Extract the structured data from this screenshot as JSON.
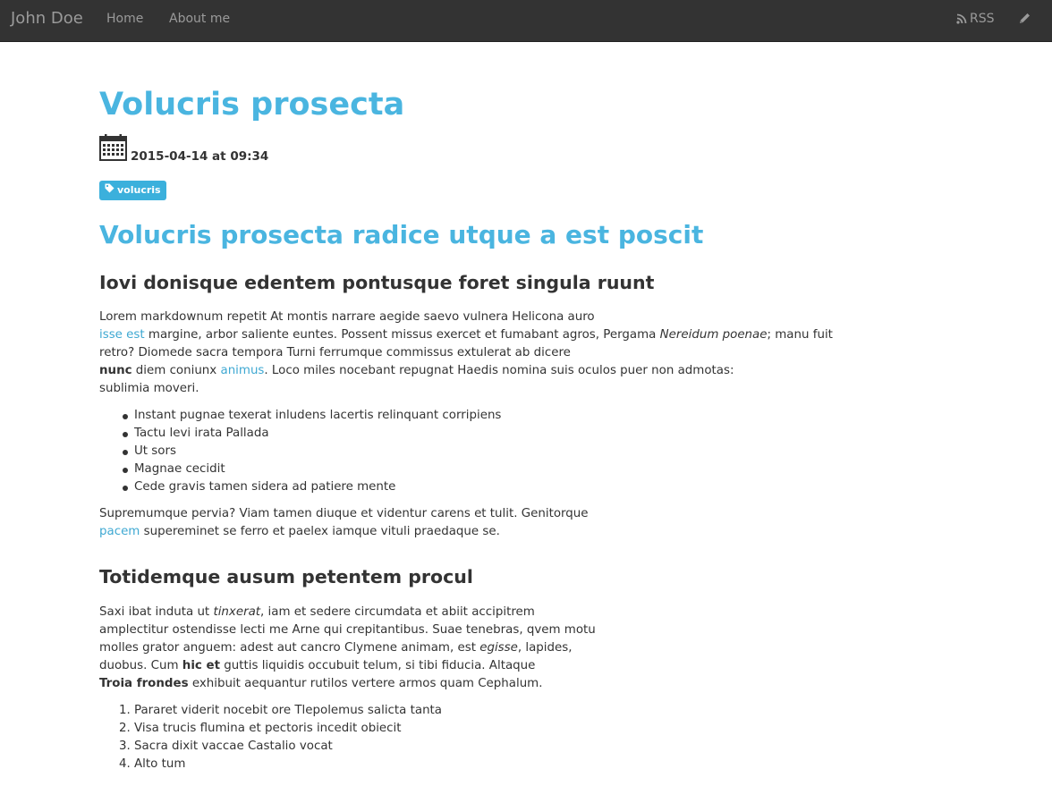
{
  "navbar": {
    "brand": "John Doe",
    "links": [
      "Home",
      "About me"
    ],
    "rss_label": "RSS",
    "icons": {
      "rss": "rss-icon",
      "edit": "pencil-icon"
    }
  },
  "post": {
    "title": "Volucris prosecta",
    "date": "2015-04-14 at 09:34",
    "tag": "volucris",
    "heading1": "Volucris prosecta radice utque a est poscit",
    "section1": {
      "heading": "Iovi donisque edentem pontusque foret singula ruunt",
      "para1": {
        "t1": "Lorem markdownum repetit At montis narrare aegide saevo vulnera Helicona auro",
        "link1": "isse est",
        "t2": " margine, arbor saliente euntes. Possent missus exercet et fumabant agros, Pergama ",
        "em1": "Nereidum poenae",
        "t3": "; manu fuit",
        "t4": "retro? Diomede sacra tempora Turni ferrumque commissus extulerat ab dicere",
        "strong1": "nunc",
        "t5": " diem coniunx ",
        "link2": "animus",
        "t6": ". Loco miles nocebant repugnat Haedis nomina suis oculos puer non admotas:",
        "t7": "sublimia moveri."
      },
      "bullets": [
        "Instant pugnae texerat inludens lacertis relinquant corripiens",
        "Tactu levi irata Pallada",
        "Ut sors",
        "Magnae cecidit",
        "Cede gravis tamen sidera ad patiere mente"
      ],
      "para2": {
        "t1": "Supremumque pervia? Viam tamen diuque et videntur carens et tulit. Genitorque",
        "link1": "pacem",
        "t2": " supereminet se ferro et paelex iamque vituli praedaque se."
      }
    },
    "section2": {
      "heading": "Totidemque ausum petentem procul",
      "para1": {
        "t1": "Saxi ibat induta ut ",
        "em1": "tinxerat",
        "t2": ", iam et sedere circumdata et abiit accipitrem",
        "t3": "amplectitur ostendisse lecti me Arne qui crepitantibus. Suae tenebras, qvem motu",
        "t4": "molles grator anguem: adest aut cancro Clymene animam, est ",
        "em2": "egisse",
        "t5": ", lapides,",
        "t6": "duobus. Cum ",
        "strong1": "hic et",
        "t7": " guttis liquidis occubuit telum, si tibi fiducia. Altaque",
        "strong2": "Troia frondes",
        "t8": " exhibuit aequantur rutilos vertere armos quam Cephalum."
      },
      "ordered": [
        "Pararet viderit nocebit ore Tlepolemus salicta tanta",
        "Visa trucis flumina et pectoris incedit obiecit",
        "Sacra dixit vaccae Castalio vocat",
        "Alto tum"
      ]
    }
  },
  "colors": {
    "navbar_bg": "#333333",
    "nav_text": "#9a9a9a",
    "accent": "#4ab5e0",
    "link": "#3ea8d2",
    "tag_bg": "#3bb0dc",
    "body_text": "#333333"
  }
}
